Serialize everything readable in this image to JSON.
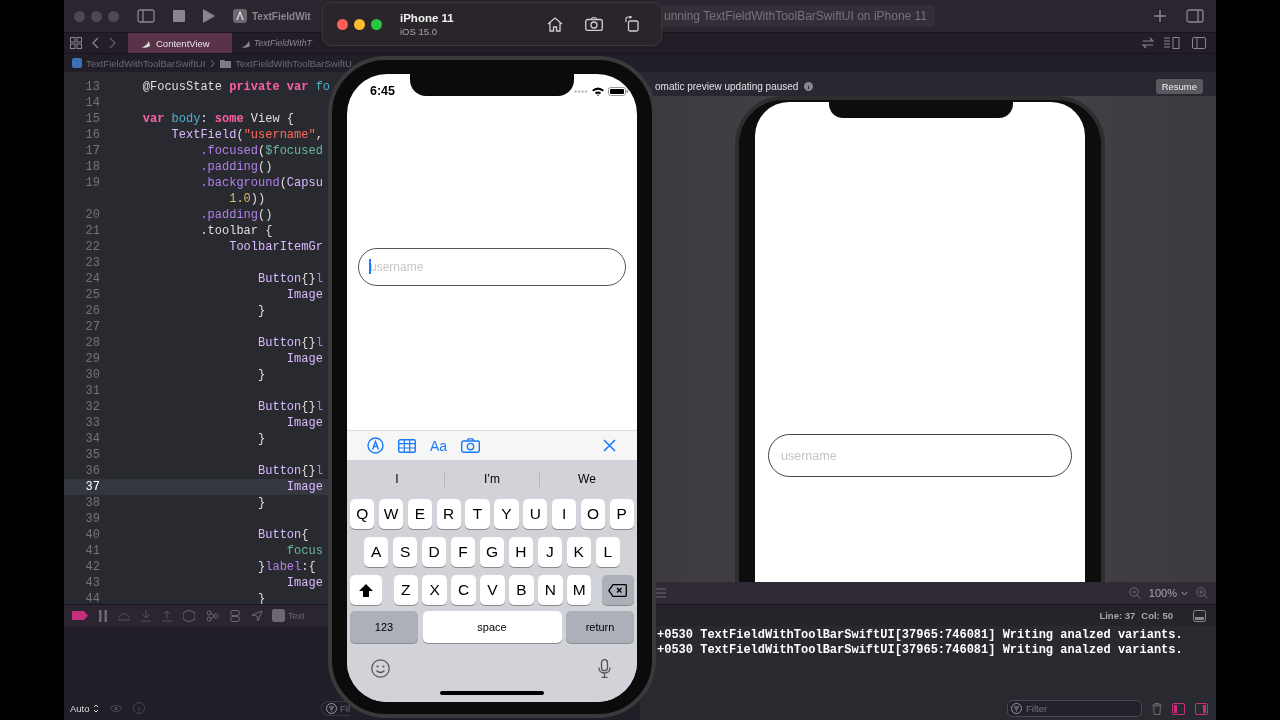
{
  "xcode": {
    "toolbar": {
      "scheme": "TextFieldWit",
      "activity": "unning TextFieldWithToolBarSwiftUI on iPhone 11"
    },
    "tabs": [
      {
        "label": "ContentView",
        "selected": true
      },
      {
        "label": "TextFieldWithT",
        "selected": false
      }
    ],
    "breadcrumb": [
      "TextFieldWithToolBarSwiftUI",
      "TextFieldWithToolBarSwiftU"
    ],
    "editor": {
      "lines": [
        {
          "number": "13",
          "selected": false,
          "tokens": [
            {
              "text": "    @FocusState ",
              "kind": "plain"
            },
            {
              "text": "private var ",
              "kind": "kw"
            },
            {
              "text": "fo",
              "kind": "decl"
            }
          ]
        },
        {
          "number": "14",
          "selected": false
        },
        {
          "number": "15",
          "selected": false,
          "tokens": [
            {
              "text": "    var ",
              "kind": "kw"
            },
            {
              "text": "body",
              "kind": "decl"
            },
            {
              "text": ": ",
              "kind": "plain"
            },
            {
              "text": "some ",
              "kind": "kw"
            },
            {
              "text": "View {",
              "kind": "plain"
            }
          ]
        },
        {
          "number": "16",
          "selected": false,
          "tokens": [
            {
              "text": "        TextField",
              "kind": "type"
            },
            {
              "text": "(",
              "kind": "plain"
            },
            {
              "text": "\"username\"",
              "kind": "str"
            },
            {
              "text": ",",
              "kind": "plain"
            }
          ]
        },
        {
          "number": "17",
          "selected": false,
          "tokens": [
            {
              "text": "            .focused",
              "kind": "method"
            },
            {
              "text": "(",
              "kind": "plain"
            },
            {
              "text": "$focused",
              "kind": "var"
            }
          ]
        },
        {
          "number": "18",
          "selected": false,
          "tokens": [
            {
              "text": "            .padding",
              "kind": "method"
            },
            {
              "text": "()",
              "kind": "plain"
            }
          ]
        },
        {
          "number": "19",
          "selected": false,
          "tokens": [
            {
              "text": "            .background",
              "kind": "method"
            },
            {
              "text": "(",
              "kind": "plain"
            },
            {
              "text": "Capsu",
              "kind": "type"
            }
          ]
        },
        {
          "selected": false,
          "tokens": [
            {
              "text": "                1.0",
              "kind": "num"
            },
            {
              "text": "))",
              "kind": "plain"
            }
          ]
        },
        {
          "number": "20",
          "selected": false,
          "tokens": [
            {
              "text": "            .padding",
              "kind": "method"
            },
            {
              "text": "()",
              "kind": "plain"
            }
          ]
        },
        {
          "number": "21",
          "selected": false,
          "tokens": [
            {
              "text": "            .toolbar {",
              "kind": "plain"
            }
          ]
        },
        {
          "number": "22",
          "selected": false,
          "tokens": [
            {
              "text": "                ToolbarItemGr",
              "kind": "type"
            }
          ]
        },
        {
          "number": "23",
          "selected": false
        },
        {
          "number": "24",
          "selected": false,
          "tokens": [
            {
              "text": "                    Button",
              "kind": "type"
            },
            {
              "text": "{}",
              "kind": "plain"
            },
            {
              "text": "l",
              "kind": "method"
            }
          ]
        },
        {
          "number": "25",
          "selected": false,
          "tokens": [
            {
              "text": "                        Image",
              "kind": "type"
            }
          ]
        },
        {
          "number": "26",
          "selected": false,
          "tokens": [
            {
              "text": "                    }",
              "kind": "plain"
            }
          ]
        },
        {
          "number": "27",
          "selected": false
        },
        {
          "number": "28",
          "selected": false,
          "tokens": [
            {
              "text": "                    Button",
              "kind": "type"
            },
            {
              "text": "{}",
              "kind": "plain"
            },
            {
              "text": "l",
              "kind": "method"
            }
          ]
        },
        {
          "number": "29",
          "selected": false,
          "tokens": [
            {
              "text": "                        Image",
              "kind": "type"
            }
          ]
        },
        {
          "number": "30",
          "selected": false,
          "tokens": [
            {
              "text": "                    }",
              "kind": "plain"
            }
          ]
        },
        {
          "number": "31",
          "selected": false
        },
        {
          "number": "32",
          "selected": false,
          "tokens": [
            {
              "text": "                    Button",
              "kind": "type"
            },
            {
              "text": "{}",
              "kind": "plain"
            },
            {
              "text": "l",
              "kind": "method"
            }
          ]
        },
        {
          "number": "33",
          "selected": false,
          "tokens": [
            {
              "text": "                        Image",
              "kind": "type"
            }
          ]
        },
        {
          "number": "34",
          "selected": false,
          "tokens": [
            {
              "text": "                    }",
              "kind": "plain"
            }
          ]
        },
        {
          "number": "35",
          "selected": false
        },
        {
          "number": "36",
          "selected": false,
          "tokens": [
            {
              "text": "                    Button",
              "kind": "type"
            },
            {
              "text": "{}",
              "kind": "plain"
            },
            {
              "text": "l",
              "kind": "method"
            }
          ]
        },
        {
          "number": "37",
          "selected": true,
          "tokens": [
            {
              "text": "                        Image",
              "kind": "type"
            }
          ]
        },
        {
          "number": "38",
          "selected": false,
          "tokens": [
            {
              "text": "                    }",
              "kind": "plain"
            }
          ]
        },
        {
          "number": "39",
          "selected": false
        },
        {
          "number": "40",
          "selected": false,
          "tokens": [
            {
              "text": "                    Button",
              "kind": "type"
            },
            {
              "text": "{",
              "kind": "plain"
            }
          ]
        },
        {
          "number": "41",
          "selected": false,
          "tokens": [
            {
              "text": "                        focus",
              "kind": "var"
            }
          ]
        },
        {
          "number": "42",
          "selected": false,
          "tokens": [
            {
              "text": "                    }",
              "kind": "plain"
            },
            {
              "text": "label",
              "kind": "method"
            },
            {
              "text": ":{",
              "kind": "plain"
            }
          ]
        },
        {
          "number": "43",
          "selected": false,
          "tokens": [
            {
              "text": "                        Image",
              "kind": "type"
            }
          ]
        },
        {
          "number": "44",
          "selected": false,
          "tokens": [
            {
              "text": "                    }",
              "kind": "plain"
            }
          ]
        }
      ]
    },
    "canvas": {
      "banner": "omatic preview updating paused",
      "resume_button": "Resume",
      "preview": {
        "text_field": {
          "placeholder": "username"
        }
      },
      "zoom": "100%"
    },
    "debug_bar": {
      "target": "Text"
    },
    "status": {
      "line": "Line: 37",
      "column": "Col: 50"
    },
    "console": {
      "lines": [
        "+0530 TextFieldWithToolBarSwiftUI[37965:746081] Writing analzed variants.",
        "+0530 TextFieldWithToolBarSwiftUI[37965:746081] Writing analzed variants."
      ],
      "filter": {
        "placeholder": "Filter"
      }
    },
    "variables": {
      "scope": "Auto",
      "filter": "Fil"
    }
  },
  "simulator": {
    "device": "iPhone 11",
    "os": "iOS 15.0",
    "time": "6:45",
    "text_field": {
      "placeholder": "username",
      "focused": true
    },
    "keyboard_toolbar": {
      "format_label": "Aa"
    },
    "suggestions": [
      "I",
      "I’m",
      "We"
    ],
    "keyboard": [
      [
        {
          "kind": "letter",
          "label": "Q"
        },
        {
          "kind": "letter",
          "label": "W"
        },
        {
          "kind": "letter",
          "label": "E"
        },
        {
          "kind": "letter",
          "label": "R"
        },
        {
          "kind": "letter",
          "label": "T"
        },
        {
          "kind": "letter",
          "label": "Y"
        },
        {
          "kind": "letter",
          "label": "U"
        },
        {
          "kind": "letter",
          "label": "I"
        },
        {
          "kind": "letter",
          "label": "O"
        },
        {
          "kind": "letter",
          "label": "P"
        }
      ],
      [
        {
          "kind": "letter",
          "label": "A"
        },
        {
          "kind": "letter",
          "label": "S"
        },
        {
          "kind": "letter",
          "label": "D"
        },
        {
          "kind": "letter",
          "label": "F"
        },
        {
          "kind": "letter",
          "label": "G"
        },
        {
          "kind": "letter",
          "label": "H"
        },
        {
          "kind": "letter",
          "label": "J"
        },
        {
          "kind": "letter",
          "label": "K"
        },
        {
          "kind": "letter",
          "label": "L"
        }
      ],
      [
        {
          "kind": "shift"
        },
        {
          "kind": "letter",
          "label": "Z"
        },
        {
          "kind": "letter",
          "label": "X"
        },
        {
          "kind": "letter",
          "label": "C"
        },
        {
          "kind": "letter",
          "label": "V"
        },
        {
          "kind": "letter",
          "label": "B"
        },
        {
          "kind": "letter",
          "label": "N"
        },
        {
          "kind": "letter",
          "label": "M"
        },
        {
          "kind": "delete"
        }
      ],
      [
        {
          "kind": "mode",
          "label": "123"
        },
        {
          "kind": "space",
          "label": "space"
        },
        {
          "kind": "return",
          "label": "return"
        }
      ]
    ]
  }
}
